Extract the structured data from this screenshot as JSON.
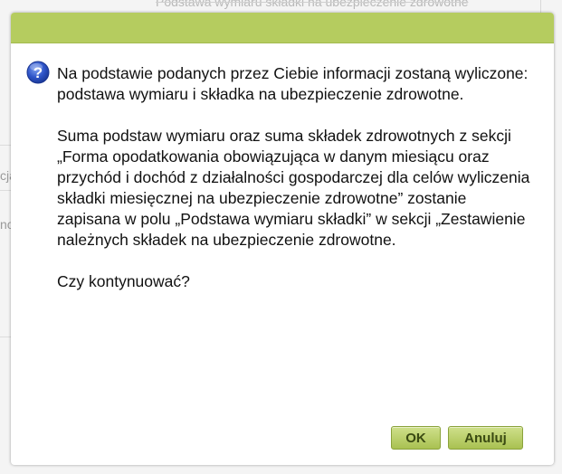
{
  "background": {
    "header_text": "Podstawa wymiaru składki na ubezpieczenie zdrowotne",
    "fragments": [
      "cja",
      "no"
    ]
  },
  "dialog": {
    "icon": "question-icon",
    "paragraphs": [
      "Na podstawie podanych przez Ciebie informacji zostaną wyliczone: podstawa wymiaru i składka na ubezpieczenie zdrowotne.",
      "Suma podstaw wymiaru oraz suma składek zdrowotnych z sekcji „Forma opodatkowania obowiązująca w danym miesiącu oraz przychód i dochód z działalności gospodarczej dla celów wyliczenia składki miesięcznej na ubezpieczenie zdrowotne” zostanie zapisana w polu „Podstawa wymiaru składki” w sekcji „Zestawienie należnych składek na ubezpieczenie zdrowotne.",
      "Czy kontynuować?"
    ],
    "buttons": {
      "ok": "OK",
      "cancel": "Anuluj"
    }
  },
  "colors": {
    "titlebar": "#b5cc5f",
    "button": "#b8cd64",
    "icon": "#2e54c8"
  }
}
